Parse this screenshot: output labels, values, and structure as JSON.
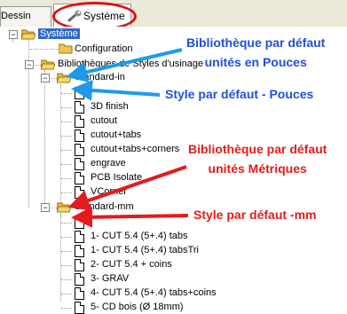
{
  "tabs": {
    "dessin": "Dessin",
    "systeme": "Système"
  },
  "tree": {
    "root": "Système",
    "configuration": "Configuration",
    "libraries": "Bibliothèques de Styles d'usinage",
    "standard_in": {
      "label": "Standard-in",
      "items": [
        "",
        "3D finish",
        "cutout",
        "cutout+tabs",
        "cutout+tabs+corners",
        "engrave",
        "PCB Isolate",
        "VCorner"
      ]
    },
    "standard_mm": {
      "label": "Standard-mm",
      "items": [
        "",
        "1- CUT 5.4 (5+.4) tabs",
        "1- CUT 5.4 (5+.4) tabsTri",
        "2- CUT 5.4 + coins",
        "3- GRAV",
        "4- CUT 5.4 (5+.4) tabs+coins",
        "5- CD bois (Ø 18mm)"
      ]
    }
  },
  "annotations": {
    "lib_pouces_line1": "Bibliothèque par défaut",
    "lib_pouces_line2": "unités en Pouces",
    "style_pouces": "Style par défaut - Pouces",
    "lib_metriques_line1": "Bibliothèque par défaut",
    "lib_metriques_line2": "unités Métriques",
    "style_mm": "Style par défaut -mm"
  },
  "colors": {
    "blue_annotation": "#1f4fe0",
    "red_annotation": "#e41b1b",
    "selection": "#316ac5"
  }
}
